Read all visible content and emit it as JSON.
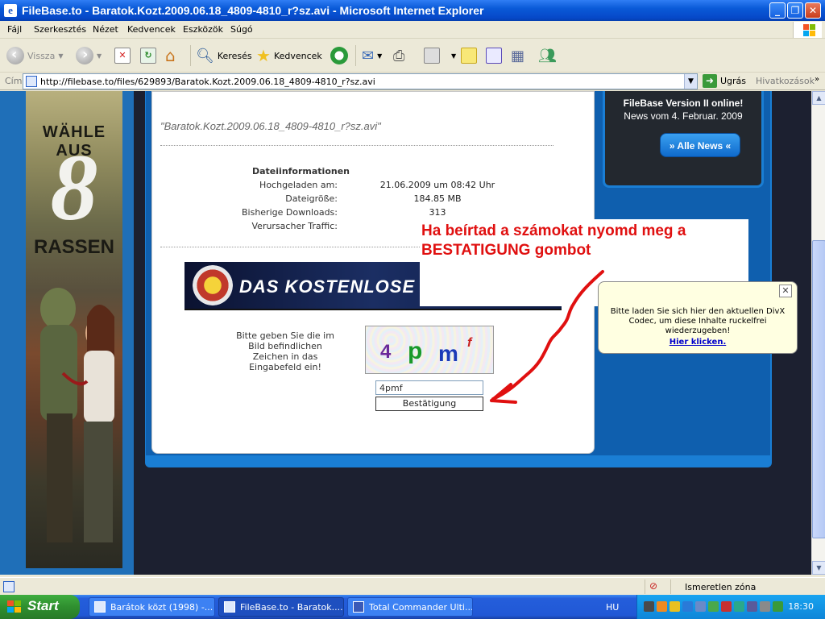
{
  "window": {
    "title": "FileBase.to - Baratok.Kozt.2009.06.18_4809-4810_r?sz.avi - Microsoft Internet Explorer"
  },
  "menu": {
    "items": [
      "Fájl",
      "Szerkesztés",
      "Nézet",
      "Kedvencek",
      "Eszközök",
      "Súgó"
    ]
  },
  "toolbar": {
    "back_label": "Vissza",
    "search_label": "Keresés",
    "favorites_label": "Kedvencek"
  },
  "address": {
    "label": "Cím",
    "url": "http://filebase.to/files/629893/Baratok.Kozt.2009.06.18_4809-4810_r?sz.avi",
    "go_label": "Ugrás",
    "links_label": "Hivatkozások"
  },
  "banner": {
    "top": "WÄHLE AUS",
    "number": "8",
    "bottom": "RASSEN"
  },
  "file": {
    "title": "\"Baratok.Kozt.2009.06.18_4809-4810_r?sz.avi\"",
    "info_heading": "Dateiinformationen",
    "rows": [
      {
        "label": "Hochgeladen am:",
        "value": "21.06.2009 um 08:42 Uhr"
      },
      {
        "label": "Dateigröße:",
        "value": "184.85 MB"
      },
      {
        "label": "Bisherige Downloads:",
        "value": "313"
      },
      {
        "label": "Verursacher Traffic:",
        "value": ""
      }
    ]
  },
  "ad": {
    "text": "DAS KOSTENLOSE B"
  },
  "captcha": {
    "instruction": "Bitte geben Sie die im Bild befindlichen Zeichen in das Eingabefeld ein!",
    "chars": [
      "4",
      "p",
      "m",
      "f"
    ],
    "input_value": "4pmf",
    "button_label": "Bestätigung"
  },
  "news": {
    "title": "FileBase Version II online!",
    "subtitle": "News vom 4. Februar. 2009",
    "button_label": "» Alle News «"
  },
  "note": {
    "text": "Ha beírtad a számokat nyomd meg a BESTATIGUNG gombot"
  },
  "divx": {
    "text": "Bitte laden Sie sich hier den aktuellen DivX Codec, um diese Inhalte ruckelfrei wiederzugeben!",
    "link": "Hier klicken."
  },
  "status": {
    "zone": "Ismeretlen zóna"
  },
  "taskbar": {
    "start_label": "Start",
    "tasks": [
      {
        "label": "Barátok közt (1998) -..."
      },
      {
        "label": "FileBase.to - Baratok...."
      },
      {
        "label": "Total Commander Ulti..."
      }
    ],
    "language": "HU",
    "clock": "18:30"
  },
  "colors": {
    "accent_blue": "#1a7ed4",
    "note_red": "#e01010",
    "taskbar_blue": "#245edb",
    "start_green": "#2f8f2f"
  }
}
